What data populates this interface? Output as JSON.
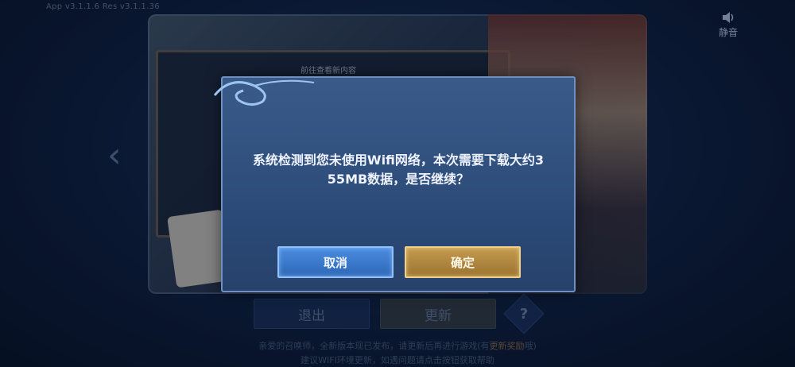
{
  "version_text": "App v3.1.1.6   Res v3.1.1.36",
  "mute": {
    "icon": "speaker-icon",
    "label": "静音"
  },
  "notice": {
    "title": "前往查看新内容"
  },
  "buttons": {
    "exit": "退出",
    "update": "更新",
    "help": "?"
  },
  "footer": {
    "line1_pre": "亲爱的召唤师，全新版本现已发布，请更新后再进行游戏(有",
    "line1_highlight": "更新奖励",
    "line1_post": "哦)",
    "line2": "建议WIFI环境更新，如遇问题请点击按钮获取帮助"
  },
  "dialog": {
    "line1": "系统检测到您未使用Wifi网络，本次需要下载大约3",
    "line2": "55MB数据，是否继续？",
    "cancel": "取消",
    "confirm": "确定"
  },
  "colors": {
    "cancel": "#2e67b6",
    "confirm": "#9c7430",
    "dialog": "#2c4b78"
  }
}
